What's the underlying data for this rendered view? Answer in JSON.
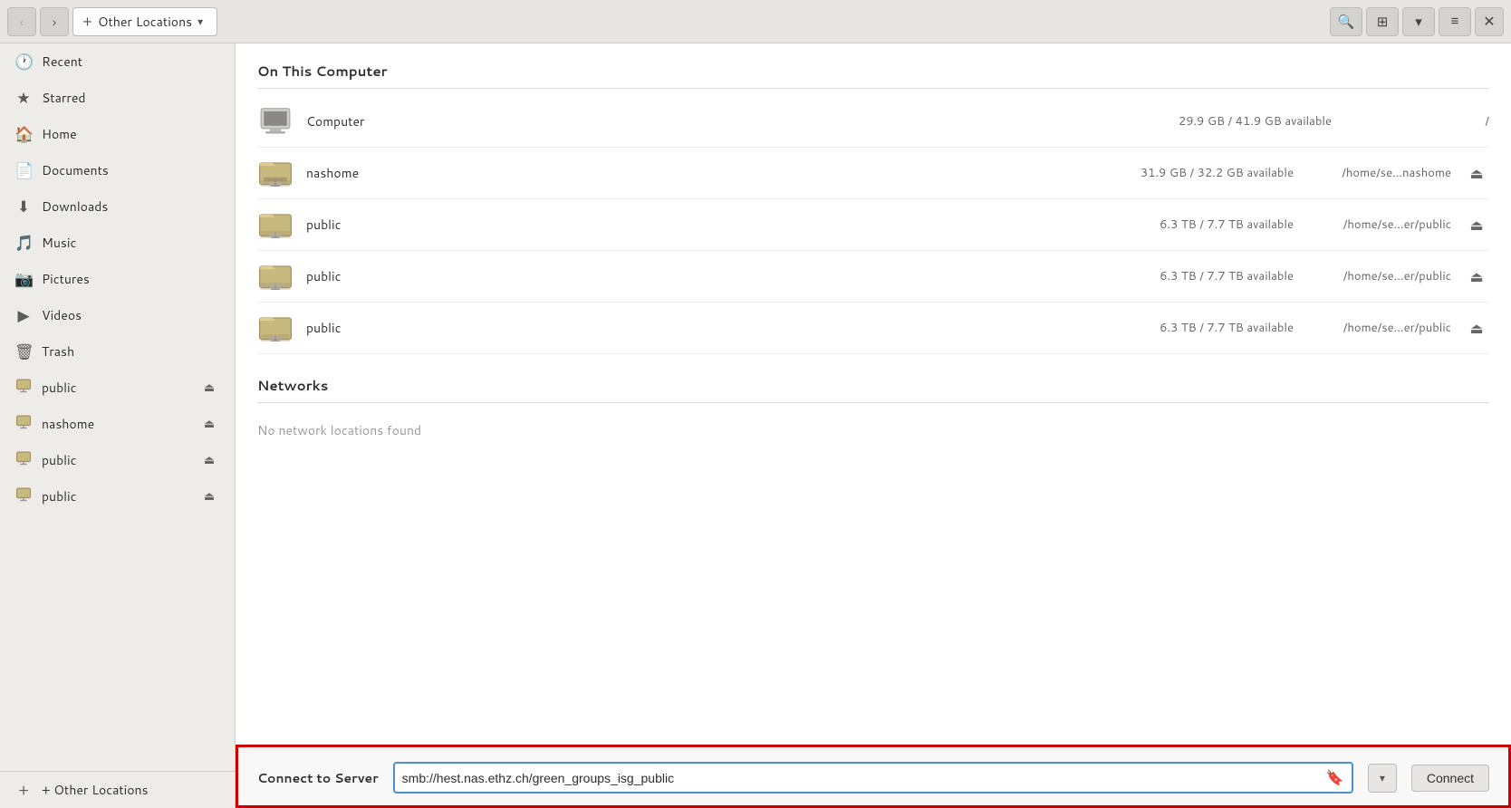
{
  "titlebar": {
    "back_label": "‹",
    "forward_label": "›",
    "plus_label": "+",
    "breadcrumb": "Other Locations",
    "dropdown_arrow": "▾",
    "search_icon": "🔍",
    "view_icon": "⊞",
    "view_dropdown": "▾",
    "menu_icon": "≡",
    "close_icon": "✕"
  },
  "sidebar": {
    "items": [
      {
        "id": "recent",
        "icon": "🕐",
        "label": "Recent"
      },
      {
        "id": "starred",
        "icon": "★",
        "label": "Starred"
      },
      {
        "id": "home",
        "icon": "🏠",
        "label": "Home"
      },
      {
        "id": "documents",
        "icon": "📄",
        "label": "Documents"
      },
      {
        "id": "downloads",
        "icon": "⬇",
        "label": "Downloads"
      },
      {
        "id": "music",
        "icon": "🎵",
        "label": "Music"
      },
      {
        "id": "pictures",
        "icon": "📷",
        "label": "Pictures"
      },
      {
        "id": "videos",
        "icon": "▶",
        "label": "Videos"
      },
      {
        "id": "trash",
        "icon": "🗑",
        "label": "Trash"
      }
    ],
    "mounts": [
      {
        "id": "public1",
        "label": "public",
        "eject": true
      },
      {
        "id": "nashome",
        "label": "nashome",
        "eject": true
      },
      {
        "id": "public2",
        "label": "public",
        "eject": true
      },
      {
        "id": "public3",
        "label": "public",
        "eject": true
      }
    ],
    "other_locations_label": "+ Other Locations"
  },
  "content": {
    "on_this_computer_title": "On This Computer",
    "networks_title": "Networks",
    "no_network_label": "No network locations found",
    "locations": [
      {
        "id": "computer",
        "name": "Computer",
        "type": "computer",
        "size": "29.9 GB / 41.9 GB available",
        "path": "/",
        "eject": false
      },
      {
        "id": "nashome",
        "name": "nashome",
        "type": "network-folder",
        "size": "31.9 GB / 32.2 GB available",
        "path": "/home/se…nashome",
        "eject": true
      },
      {
        "id": "public1",
        "name": "public",
        "type": "network-folder",
        "size": "6.3 TB / 7.7 TB available",
        "path": "/home/se…er/public",
        "eject": true
      },
      {
        "id": "public2",
        "name": "public",
        "type": "network-folder",
        "size": "6.3 TB / 7.7 TB available",
        "path": "/home/se…er/public",
        "eject": true
      },
      {
        "id": "public3",
        "name": "public",
        "type": "network-folder",
        "size": "6.3 TB / 7.7 TB available",
        "path": "/home/se…er/public",
        "eject": true
      }
    ]
  },
  "connect_to_server": {
    "label": "Connect to Server",
    "input_value": "smb://hest.nas.ethz.ch/green_groups_isg_public",
    "button_label": "Connect"
  }
}
